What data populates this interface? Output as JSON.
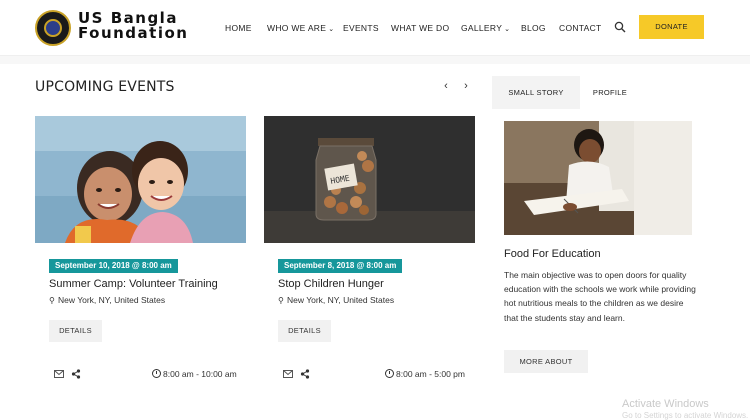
{
  "header": {
    "brand_line1": "US Bangla",
    "brand_line2": "Foundation",
    "nav": {
      "home": "HOME",
      "who": "WHO WE ARE",
      "events": "EVENTS",
      "whatwedo": "WHAT WE DO",
      "gallery": "GALLERY",
      "blog": "BLOG",
      "contact": "CONTACT"
    },
    "donate_label": "DONATE",
    "accent_color": "#f6c928"
  },
  "events_section": {
    "title": "UPCOMING EVENTS",
    "prev_icon": "chevron-left-icon",
    "next_icon": "chevron-right-icon",
    "badge_color": "#16979b",
    "events": [
      {
        "date": "September 10, 2018 @ 8:00 am",
        "title": "Summer Camp: Volunteer Training",
        "location": "New York, NY, United States",
        "details_label": "DETAILS",
        "time": "8:00 am - 10:00 am"
      },
      {
        "date": "September 8, 2018 @ 8:00 am",
        "title": "Stop Children Hunger",
        "location": "New York, NY, United States",
        "details_label": "DETAILS",
        "time": "8:00 am - 5:00 pm",
        "jar_label": "HOME"
      }
    ]
  },
  "sidebar": {
    "tabs": [
      "SMALL STORY",
      "PROFILE"
    ],
    "story_title": "Food For Education",
    "story_text": "The main objective was to open doors for quality education with the schools we work while providing hot nutritious meals to the children as we desire that the students stay and learn.",
    "more_label": "MORE ABOUT"
  },
  "watermark": {
    "line1": "Activate Windows",
    "line2": "Go to Settings to activate Windows."
  }
}
